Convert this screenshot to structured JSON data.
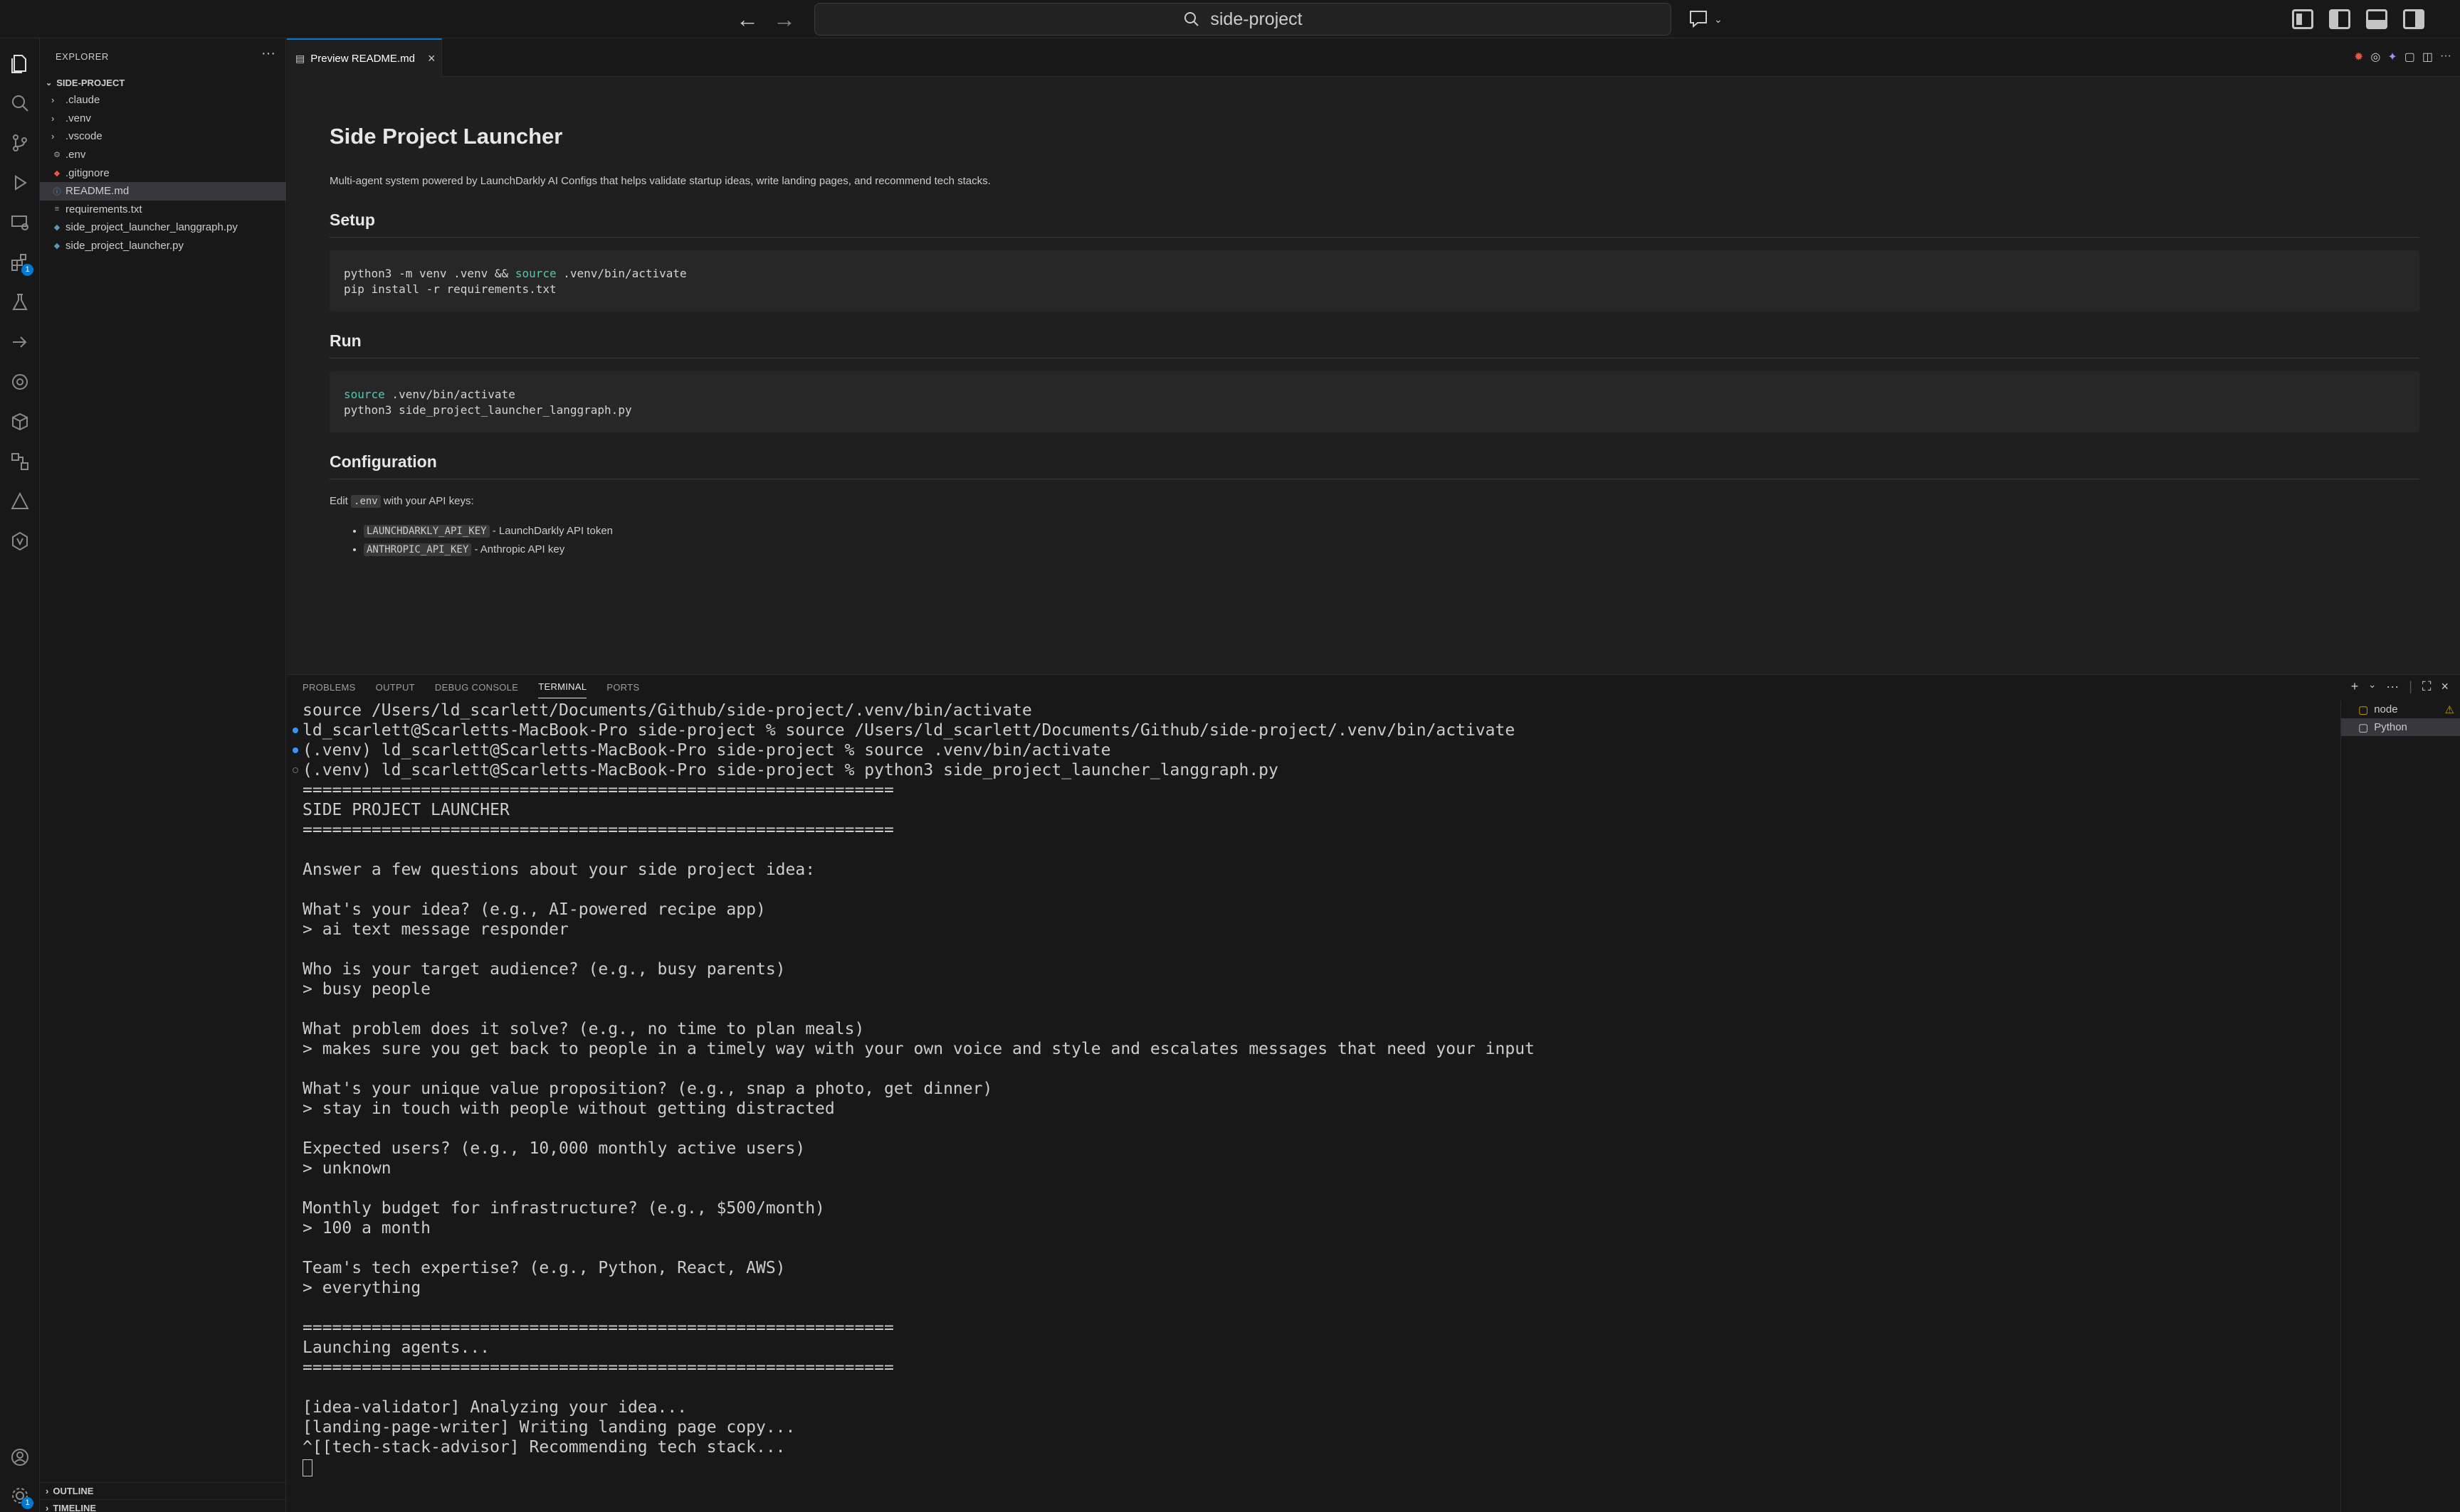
{
  "titlebar": {
    "search_text": "side-project"
  },
  "sidebar": {
    "header": "EXPLORER",
    "folder": "SIDE-PROJECT",
    "items": [
      {
        "label": ".claude",
        "kind": "folder"
      },
      {
        "label": ".venv",
        "kind": "folder"
      },
      {
        "label": ".vscode",
        "kind": "folder"
      },
      {
        "label": ".env",
        "kind": "gear"
      },
      {
        "label": ".gitignore",
        "kind": "git"
      },
      {
        "label": "README.md",
        "kind": "info",
        "selected": true
      },
      {
        "label": "requirements.txt",
        "kind": "text"
      },
      {
        "label": "side_project_launcher_langgraph.py",
        "kind": "python"
      },
      {
        "label": "side_project_launcher.py",
        "kind": "python"
      }
    ],
    "outline": "OUTLINE",
    "timeline": "TIMELINE"
  },
  "activity_badges": {
    "extensions": "1",
    "accounts": "1"
  },
  "editor": {
    "tab_label": "Preview README.md",
    "title": "Side Project Launcher",
    "intro": "Multi-agent system powered by LaunchDarkly AI Configs that helps validate startup ideas, write landing pages, and recommend tech stacks.",
    "setup_heading": "Setup",
    "setup_code_1_pre": "python3 -m venv .venv && ",
    "setup_code_1_kw": "source",
    "setup_code_1_post": " .venv/bin/activate",
    "setup_code_2": "pip install -r requirements.txt",
    "run_heading": "Run",
    "run_code_1_kw": "source",
    "run_code_1_post": " .venv/bin/activate",
    "run_code_2": "python3 side_project_launcher_langgraph.py",
    "config_heading": "Configuration",
    "config_pre": "Edit ",
    "config_code": ".env",
    "config_post": " with your API keys:",
    "keys": [
      {
        "code": "LAUNCHDARKLY_API_KEY",
        "desc": " - LaunchDarkly API token"
      },
      {
        "code": "ANTHROPIC_API_KEY",
        "desc": " - Anthropic API key"
      }
    ]
  },
  "panel": {
    "tabs": [
      "PROBLEMS",
      "OUTPUT",
      "DEBUG CONSOLE",
      "TERMINAL",
      "PORTS"
    ],
    "active_tab": "TERMINAL",
    "terminals": [
      "node",
      "Python"
    ]
  },
  "terminal_lines": [
    {
      "text": "source /Users/ld_scarlett/Documents/Github/side-project/.venv/bin/activate",
      "dot": ""
    },
    {
      "text": "ld_scarlett@Scarletts-MacBook-Pro side-project % source /Users/ld_scarlett/Documents/Github/side-project/.venv/bin/activate",
      "dot": "blue"
    },
    {
      "text": "(.venv) ld_scarlett@Scarletts-MacBook-Pro side-project % source .venv/bin/activate",
      "dot": "blue"
    },
    {
      "text": "(.venv) ld_scarlett@Scarletts-MacBook-Pro side-project % python3 side_project_launcher_langgraph.py",
      "dot": "hollow"
    },
    {
      "text": "============================================================",
      "dot": ""
    },
    {
      "text": "SIDE PROJECT LAUNCHER",
      "dot": ""
    },
    {
      "text": "============================================================",
      "dot": ""
    },
    {
      "text": "",
      "dot": ""
    },
    {
      "text": "Answer a few questions about your side project idea:",
      "dot": ""
    },
    {
      "text": "",
      "dot": ""
    },
    {
      "text": "What's your idea? (e.g., AI-powered recipe app)",
      "dot": ""
    },
    {
      "text": "> ai text message responder",
      "dot": ""
    },
    {
      "text": "",
      "dot": ""
    },
    {
      "text": "Who is your target audience? (e.g., busy parents)",
      "dot": ""
    },
    {
      "text": "> busy people",
      "dot": ""
    },
    {
      "text": "",
      "dot": ""
    },
    {
      "text": "What problem does it solve? (e.g., no time to plan meals)",
      "dot": ""
    },
    {
      "text": "> makes sure you get back to people in a timely way with your own voice and style and escalates messages that need your input",
      "dot": ""
    },
    {
      "text": "",
      "dot": ""
    },
    {
      "text": "What's your unique value proposition? (e.g., snap a photo, get dinner)",
      "dot": ""
    },
    {
      "text": "> stay in touch with people without getting distracted",
      "dot": ""
    },
    {
      "text": "",
      "dot": ""
    },
    {
      "text": "Expected users? (e.g., 10,000 monthly active users)",
      "dot": ""
    },
    {
      "text": "> unknown",
      "dot": ""
    },
    {
      "text": "",
      "dot": ""
    },
    {
      "text": "Monthly budget for infrastructure? (e.g., $500/month)",
      "dot": ""
    },
    {
      "text": "> 100 a month",
      "dot": ""
    },
    {
      "text": "",
      "dot": ""
    },
    {
      "text": "Team's tech expertise? (e.g., Python, React, AWS)",
      "dot": ""
    },
    {
      "text": "> everything",
      "dot": ""
    },
    {
      "text": "",
      "dot": ""
    },
    {
      "text": "============================================================",
      "dot": ""
    },
    {
      "text": "Launching agents...",
      "dot": ""
    },
    {
      "text": "============================================================",
      "dot": ""
    },
    {
      "text": "",
      "dot": ""
    },
    {
      "text": "[idea-validator] Analyzing your idea...",
      "dot": ""
    },
    {
      "text": "[landing-page-writer] Writing landing page copy...",
      "dot": ""
    },
    {
      "text": "^[[tech-stack-advisor] Recommending tech stack...",
      "dot": ""
    }
  ]
}
